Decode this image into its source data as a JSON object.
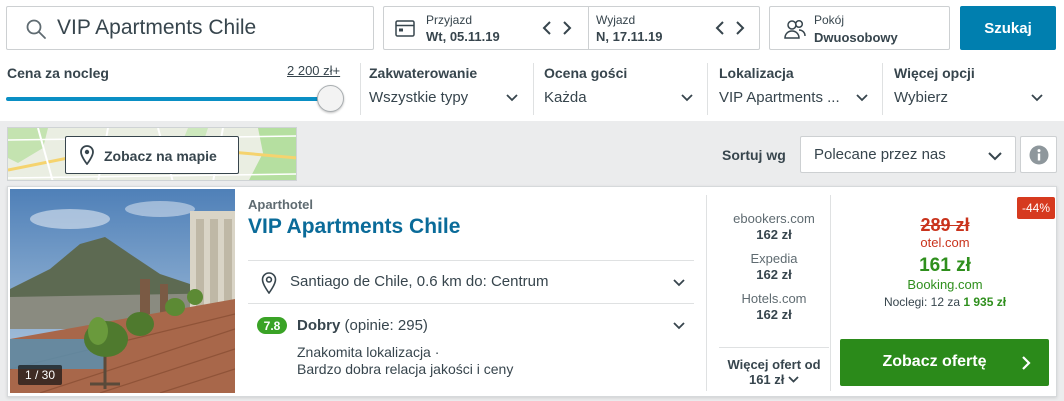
{
  "search": {
    "query": "VIP Apartments Chile",
    "search_icon": "search-icon",
    "checkin": {
      "label": "Przyjazd",
      "value": "Wt, 05.11.19"
    },
    "checkout": {
      "label": "Wyjazd",
      "value": "N, 17.11.19"
    },
    "room": {
      "label": "Pokój",
      "value": "Dwuosobowy",
      "icon": "guests-icon"
    },
    "submit_label": "Szukaj",
    "colors": {
      "accent": "#007faf"
    }
  },
  "filters": {
    "price": {
      "label": "Cena za nocleg",
      "max": "2 200 zł+",
      "slider_level": 1.0
    },
    "accommodation": {
      "label": "Zakwaterowanie",
      "value": "Wszystkie typy"
    },
    "rating": {
      "label": "Ocena gości",
      "value": "Każda"
    },
    "location": {
      "label": "Lokalizacja",
      "value": "VIP Apartments ..."
    },
    "more": {
      "label": "Więcej opcji",
      "value": "Wybierz"
    }
  },
  "map": {
    "button_label": "Zobacz na mapie",
    "icon": "map-pin-icon"
  },
  "sort": {
    "label": "Sortuj wg",
    "value": "Polecane przez nas",
    "info_icon": "info-icon"
  },
  "hotel": {
    "type": "Aparthotel",
    "name": "VIP Apartments Chile",
    "image_counter": "1 / 30",
    "location": "Santiago de Chile, 0.6 km do: Centrum",
    "rating_score": "7.8",
    "rating_word": "Dobry",
    "rating_reviews": "(opinie: 295)",
    "review_snippets": [
      "Znakomita lokalizacja ·",
      "Bardzo dobra relacja jakości i ceny"
    ],
    "deals": [
      {
        "site": "ebookers.com",
        "price": "162 zł"
      },
      {
        "site": "Expedia",
        "price": "162 zł"
      },
      {
        "site": "Hotels.com",
        "price": "162 zł"
      }
    ],
    "more_offers_line1": "Więcej ofert od",
    "more_offers_line2": "161 zł",
    "discount": "-44%",
    "old_price": "289 zł",
    "old_site": "otel.com",
    "best_price": "161 zł",
    "best_site": "Booking.com",
    "nights_prefix": "Noclegi: 12 za",
    "nights_total": "1 935 zł",
    "cta_label": "Zobacz ofertę",
    "colors": {
      "cta": "#2b8a1a",
      "discount": "#d63a1f",
      "rating": "#3aa326",
      "link": "#0a6b99"
    }
  }
}
